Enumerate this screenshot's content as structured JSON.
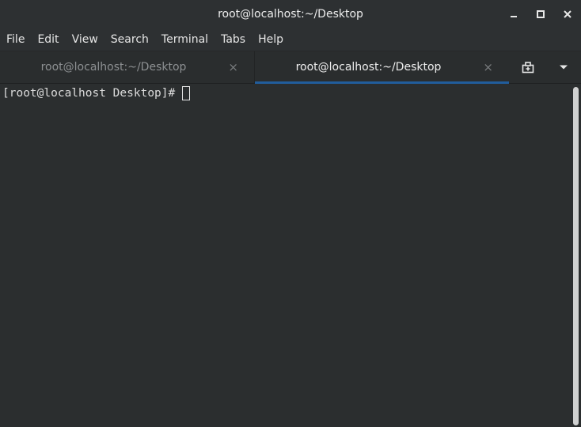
{
  "window": {
    "title": "root@localhost:~/Desktop",
    "controls": {
      "minimize": "minimize-icon",
      "maximize": "maximize-icon",
      "close": "close-icon"
    }
  },
  "menubar": {
    "items": [
      "File",
      "Edit",
      "View",
      "Search",
      "Terminal",
      "Tabs",
      "Help"
    ]
  },
  "tabs": [
    {
      "label": "root@localhost:~/Desktop",
      "close": "×",
      "active": false
    },
    {
      "label": "root@localhost:~/Desktop",
      "close": "×",
      "active": true
    }
  ],
  "terminal": {
    "prompt": "[root@localhost Desktop]#"
  },
  "colors": {
    "active_tab_indicator": "#215d9c",
    "background": "#2b2e2f"
  }
}
